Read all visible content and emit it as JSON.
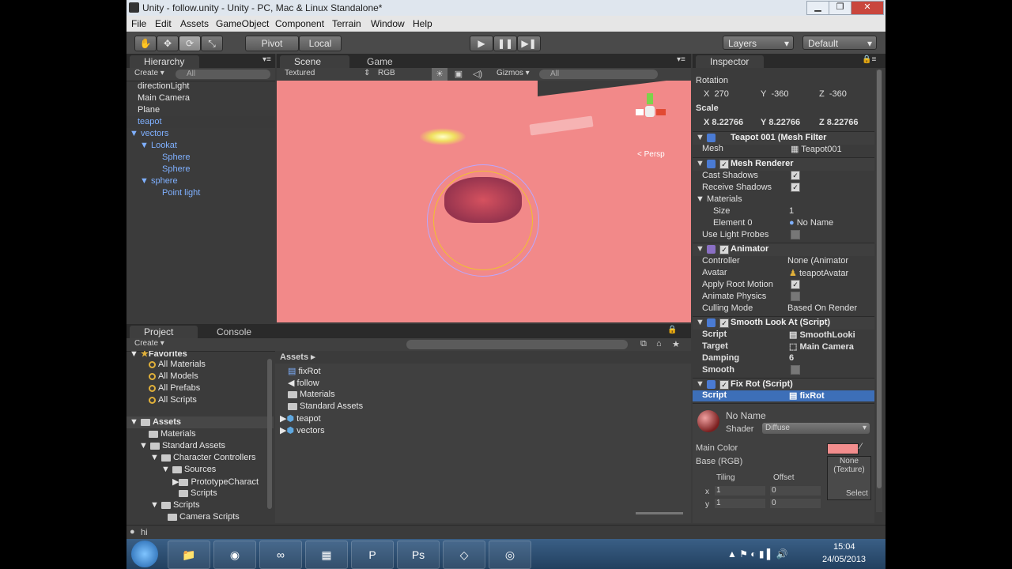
{
  "window": {
    "title": "Unity - follow.unity - Unity - PC, Mac & Linux Standalone*"
  },
  "menu": [
    "File",
    "Edit",
    "Assets",
    "GameObject",
    "Component",
    "Terrain",
    "Window",
    "Help"
  ],
  "toolbar": {
    "pivot": "Pivot",
    "local": "Local",
    "layers": "Layers",
    "layout": "Default"
  },
  "hierarchy": {
    "tab": "Hierarchy",
    "create": "Create",
    "search_placeholder": "All",
    "items": [
      "directionLight",
      "Main Camera",
      "Plane",
      "teapot",
      "vectors",
      "Lookat",
      "Sphere",
      "Sphere",
      "sphere",
      "Point light"
    ]
  },
  "scene": {
    "tab_scene": "Scene",
    "tab_game": "Game",
    "render_mode": "Textured",
    "color_mode": "RGB",
    "gizmos": "Gizmos",
    "search_placeholder": "All",
    "persp_label": "< Persp"
  },
  "project": {
    "tab_project": "Project",
    "tab_console": "Console",
    "create": "Create",
    "favorites_label": "Favorites",
    "favorites": [
      "All Materials",
      "All Models",
      "All Prefabs",
      "All Scripts"
    ],
    "assets_label": "Assets",
    "tree": [
      "Materials",
      "Standard Assets",
      "Character Controllers",
      "Sources",
      "PrototypeCharact",
      "Scripts",
      "Scripts",
      "Camera Scripts"
    ],
    "breadcrumb": "Assets",
    "files": [
      "fixRot",
      "follow",
      "Materials",
      "Standard Assets",
      "teapot",
      "vectors"
    ]
  },
  "inspector": {
    "tab": "Inspector",
    "rotation_label": "Rotation",
    "rotation": {
      "x": "270",
      "y": "-360",
      "z": "-360"
    },
    "scale_label": "Scale",
    "scale": {
      "x": "8.22766",
      "y": "8.22766",
      "z": "8.22766"
    },
    "mesh_filter_title": "Teapot 001 (Mesh Filter",
    "mesh_label": "Mesh",
    "mesh_value": "Teapot001",
    "mesh_renderer_title": "Mesh Renderer",
    "cast_shadows": "Cast Shadows",
    "receive_shadows": "Receive Shadows",
    "materials": "Materials",
    "size_label": "Size",
    "size_value": "1",
    "element0_label": "Element 0",
    "element0_value": "No Name",
    "use_light_probes": "Use Light Probes",
    "animator_title": "Animator",
    "controller_label": "Controller",
    "controller_value": "None (Animator",
    "avatar_label": "Avatar",
    "avatar_value": "teapotAvatar",
    "apply_root_motion": "Apply Root Motion",
    "animate_physics": "Animate Physics",
    "culling_mode_label": "Culling Mode",
    "culling_mode_value": "Based On Render",
    "smooth_title": "Smooth Look At (Script)",
    "script_label": "Script",
    "smooth_script_value": "SmoothLooki",
    "target_label": "Target",
    "target_value": "Main Camera",
    "damping_label": "Damping",
    "damping_value": "6",
    "smooth_label": "Smooth",
    "fixrot_title": "Fix Rot (Script)",
    "fixrot_script_value": "fixRot",
    "material_name": "No Name",
    "shader_label": "Shader",
    "shader_value": "Diffuse",
    "main_color_label": "Main Color",
    "main_color": "#f28d8d",
    "base_label": "Base (RGB)",
    "texture_none": "None\n(Texture)",
    "select": "Select",
    "tiling": "Tiling",
    "offset": "Offset",
    "x_label": "x",
    "y_label": "y",
    "tiling_x": "1",
    "tiling_y": "1",
    "offset_x": "0",
    "offset_y": "0"
  },
  "status": {
    "message": "hi"
  },
  "taskbar": {
    "time": "15:04",
    "date": "24/05/2013"
  },
  "colors": {
    "scene_bg": "#f28989",
    "panel_bg": "#3b3b3b",
    "selection": "#3d6fb8"
  }
}
